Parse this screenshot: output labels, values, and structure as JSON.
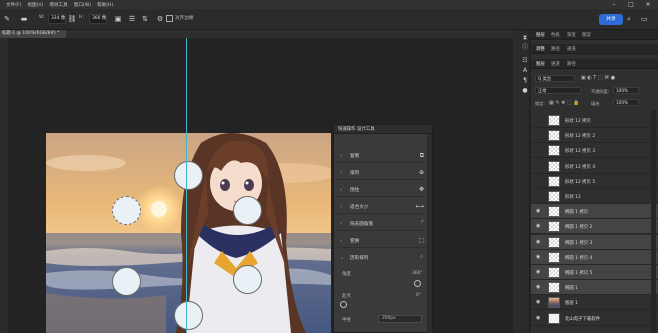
{
  "menu": [
    "文件(F)",
    "视图(V)",
    "增效工具",
    "窗口(W)",
    "帮助(H)"
  ],
  "options": {
    "w_label": "W:",
    "w_value": "334 像",
    "link_icon": "link-icon",
    "h_label": "H:",
    "h_value": "366 像",
    "align_edges": "对齐边缘"
  },
  "share_label": "共享",
  "doc_tab": "标题-1 @ 100%(RGB/8#) *",
  "props": {
    "title": "快速操作  设计工具",
    "rows": [
      {
        "label": "复制"
      },
      {
        "label": "排列"
      },
      {
        "label": "围住"
      },
      {
        "label": "适合大小"
      },
      {
        "label": "除去圆角落"
      },
      {
        "label": "变换"
      },
      {
        "label": "历形排列"
      }
    ],
    "angle_label": "角度",
    "angle_value": "360°",
    "start_label": "起点",
    "start_value": "0°",
    "radius_label": "半径",
    "radius_value": "200px"
  },
  "right_panel": {
    "top_tabs": [
      "图层",
      "色板",
      "渐变",
      "图案"
    ],
    "second_tabs": [
      "调整",
      "路径",
      "通道"
    ],
    "layers_tabs": [
      "图层",
      "通道",
      "路径"
    ],
    "filter_label": "Q 类型",
    "blend_mode": "正常",
    "opacity_label": "不透明度:",
    "opacity_value": "100%",
    "lock_label": "锁定:",
    "fill_label": "填充:",
    "fill_value": "100%",
    "layers": [
      {
        "name": "形状 12 拷贝",
        "thumb": "checker",
        "eye": false,
        "selected": false
      },
      {
        "name": "形状 12 拷贝 2",
        "thumb": "checker",
        "eye": false,
        "selected": false
      },
      {
        "name": "形状 12 拷贝 3",
        "thumb": "checker",
        "eye": false,
        "selected": false
      },
      {
        "name": "形状 12 拷贝 4",
        "thumb": "checker",
        "eye": false,
        "selected": false
      },
      {
        "name": "形状 12 拷贝 5",
        "thumb": "checker",
        "eye": false,
        "selected": false
      },
      {
        "name": "形状 12",
        "thumb": "checker",
        "eye": false,
        "selected": false
      },
      {
        "name": "椭圆 1 拷贝",
        "thumb": "checker",
        "eye": true,
        "selected": true
      },
      {
        "name": "椭圆 1 拷贝 2",
        "thumb": "checker",
        "eye": true,
        "selected": true
      },
      {
        "name": "椭圆 1 拷贝 3",
        "thumb": "checker",
        "eye": true,
        "selected": true
      },
      {
        "name": "椭圆 1 拷贝 4",
        "thumb": "checker",
        "eye": true,
        "selected": true
      },
      {
        "name": "椭圆 1 拷贝 5",
        "thumb": "checker",
        "eye": true,
        "selected": true
      },
      {
        "name": "椭圆 1",
        "thumb": "checker",
        "eye": true,
        "selected": true
      },
      {
        "name": "图层 1",
        "thumb": "photo",
        "eye": true,
        "selected": false
      },
      {
        "name": "北山电子下载软件",
        "thumb": "white",
        "eye": true,
        "selected": false
      }
    ]
  },
  "colors": {
    "accent": "#2f6bd6",
    "guide": "#3fb7c7",
    "selected_layer": "#444444"
  }
}
